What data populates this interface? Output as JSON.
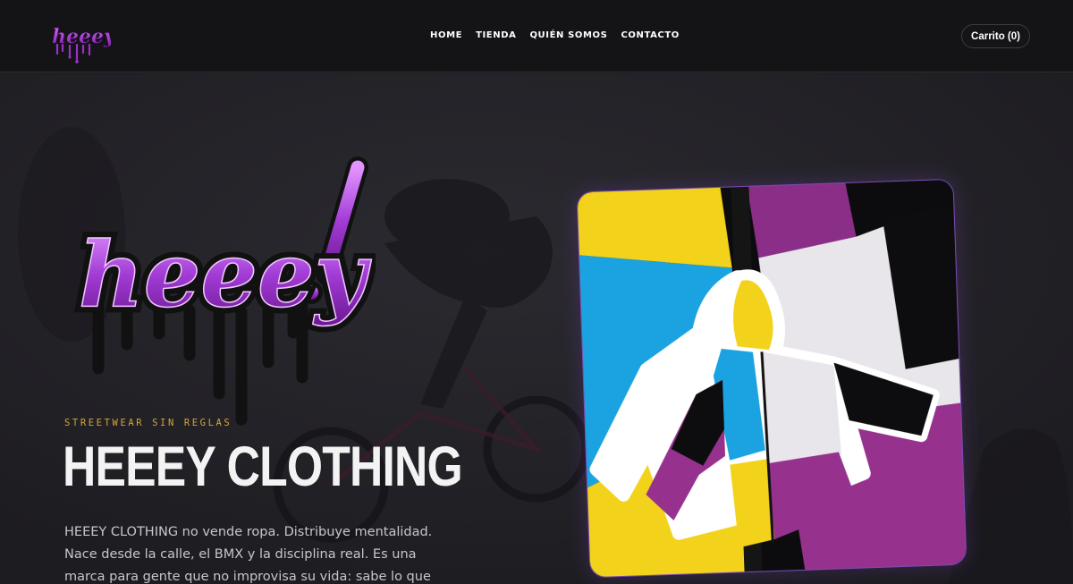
{
  "header": {
    "logo_text": "heeey!",
    "nav": [
      {
        "label": "HOME"
      },
      {
        "label": "TIENDA"
      },
      {
        "label": "QUIÉN SOMOS"
      },
      {
        "label": "CONTACTO"
      }
    ],
    "cart_label": "Carrito (0)"
  },
  "hero": {
    "logo_text": "heeey!",
    "tagline": "STREETWEAR SIN REGLAS",
    "title": "HEEEY CLOTHING",
    "description": "HEEEY CLOTHING no vende ropa. Distribuye mentalidad. Nace desde la calle, el BMX y la disciplina real. Es una marca para gente que no improvisa su vida: sabe lo que quiere y"
  },
  "colors": {
    "accent_purple": "#9b30c8",
    "tagline_gold": "#d5a439",
    "jacket_yellow": "#f2d21a",
    "jacket_blue": "#1aa3e0",
    "jacket_magenta": "#96328e"
  },
  "icons": {
    "logo": "drip-graffiti-logo",
    "product": "jacket-image"
  }
}
